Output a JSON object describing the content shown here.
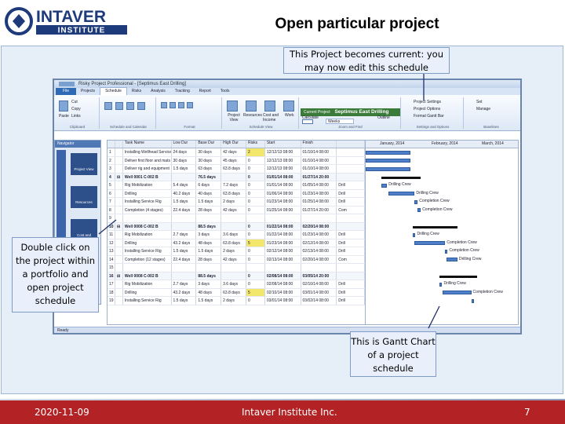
{
  "slide": {
    "title": "Open particular project",
    "logo_text": "INTAVER",
    "logo_subtext": "INSTITUTE",
    "date": "2020-11-09",
    "company": "Intaver Institute Inc.",
    "page_number": "7"
  },
  "callouts": {
    "project_current": "This Project becomes current: you may now edit this schedule",
    "double_click": "Double click on the project within a portfolio and open project schedule",
    "gantt": "This is Gantt Chart of a project schedule"
  },
  "colors": {
    "footer_bg": "#b32225",
    "logo_blue": "#1d3b7a",
    "current_project_bar": "#3a7b3a",
    "gantt_bar": "#4f7fc9"
  },
  "app": {
    "title": "Risky Project Professional - [Septimus East Drilling]",
    "file_tab": "File",
    "tabs": [
      "Projects",
      "Schedule",
      "Risks",
      "Analysis",
      "Tracking",
      "Report",
      "Tools"
    ],
    "active_tab": "Schedule",
    "current_project_label": "Current Project",
    "current_project": "Septimus East Drilling",
    "ribbon_groups": [
      "Clipboard",
      "Schedule and Calendar",
      "Format",
      "Schedule View",
      "Zoom and Find",
      "Settings and Options",
      "Baselines"
    ],
    "ribbon_buttons": {
      "cut": "Cut",
      "copy": "Copy",
      "paste": "Paste",
      "links": "Links",
      "project_view": "Project View",
      "resources": "Resources",
      "cost_income": "Cost and Income",
      "work": "Work",
      "calculate": "Calculate",
      "outline": "Outline",
      "weeks": "Weeks",
      "project_settings": "Project Settings",
      "project_options": "Project Options",
      "format_gantt": "Format Gantt Bar",
      "set": "Set",
      "manage": "Manage"
    },
    "navigator": {
      "title": "Navigator",
      "strip_labels": [
        "Projects",
        "Schedule"
      ],
      "buttons": [
        "Project View",
        "Resources",
        "Cost and"
      ]
    },
    "grid": {
      "headers": [
        "",
        "",
        "Task Name",
        "Low Dur",
        "Base Dur",
        "High Dur",
        "Risks",
        "Start",
        "Finish",
        ""
      ],
      "rows": [
        [
          "1",
          "",
          "Installing Wellhead Service",
          "24 days",
          "30 days",
          "42 days",
          "2",
          "12/12/13 08:00",
          "01/10/14 08:00",
          ""
        ],
        [
          "2",
          "",
          "Deliver first floor and mats",
          "30 days",
          "30 days",
          "45 days",
          "0",
          "12/12/13 08:00",
          "01/10/14 08:00",
          ""
        ],
        [
          "3",
          "",
          "Deliver rig and equipment",
          "1.5 days",
          "63 days",
          "63.8 days",
          "0",
          "12/12/13 08:00",
          "01/10/14 08:00",
          ""
        ],
        [
          "4",
          "⊟",
          "Well 0001 C-002 B",
          "",
          "76.5 days",
          "",
          "0",
          "01/01/14 08:00",
          "01/27/14 20:00",
          ""
        ],
        [
          "5",
          "",
          "Rig Mobilization",
          "5.4 days",
          "6 days",
          "7.2 days",
          "0",
          "01/01/14 08:00",
          "01/05/14 08:00",
          "Drill"
        ],
        [
          "6",
          "",
          "Drilling",
          "40.2 days",
          "40 days",
          "63.8 days",
          "0",
          "01/06/14 08:00",
          "01/23/14 08:00",
          "Drill"
        ],
        [
          "7",
          "",
          "Installing Service Rig",
          "1.5 days",
          "1.5 days",
          "2 days",
          "0",
          "01/23/14 08:00",
          "01/25/14 08:00",
          "Drill"
        ],
        [
          "8",
          "",
          "Completion (4 stages)",
          "22.4 days",
          "28 days",
          "42 days",
          "0",
          "01/25/14 08:00",
          "01/27/14 20:00",
          "Com"
        ],
        [
          "9",
          "",
          "",
          "",
          "",
          "",
          "",
          "",
          "",
          ""
        ],
        [
          "10",
          "⊟",
          "Well 0008 C-002 B",
          "",
          "88.5 days",
          "",
          "0",
          "01/22/14 08:00",
          "02/20/14 08:00",
          ""
        ],
        [
          "11",
          "",
          "Rig Mobilization",
          "2.7 days",
          "3 days",
          "3.6 days",
          "0",
          "01/22/14 08:00",
          "01/23/14 08:00",
          "Drill"
        ],
        [
          "12",
          "",
          "Drilling",
          "43.2 days",
          "48 days",
          "63.8 days",
          "5",
          "01/23/14 08:00",
          "02/12/14 08:00",
          "Drill"
        ],
        [
          "13",
          "",
          "Installing Service Rig",
          "1.5 days",
          "1.5 days",
          "2 days",
          "0",
          "02/12/14 08:00",
          "02/13/14 08:00",
          "Drill"
        ],
        [
          "14",
          "",
          "Completion (12 stages)",
          "22.4 days",
          "28 days",
          "42 days",
          "0",
          "02/13/14 08:00",
          "02/20/14 08:00",
          "Com"
        ],
        [
          "15",
          "",
          "",
          "",
          "",
          "",
          "",
          "",
          "",
          ""
        ],
        [
          "16",
          "⊟",
          "Well 0008 C-002 B",
          "",
          "88.5 days",
          "",
          "0",
          "02/08/14 08:00",
          "03/05/14 20:00",
          ""
        ],
        [
          "17",
          "",
          "Rig Mobilization",
          "2.7 days",
          "3 days",
          "3.6 days",
          "0",
          "02/08/14 08:00",
          "02/10/14 08:00",
          "Drill"
        ],
        [
          "18",
          "",
          "Drilling",
          "43.2 days",
          "48 days",
          "63.8 days",
          "5",
          "02/10/14 08:00",
          "03/01/14 08:00",
          "Drill"
        ],
        [
          "19",
          "",
          "Installing Service Rig",
          "1.5 days",
          "1.5 days",
          "2 days",
          "0",
          "03/01/14 08:00",
          "03/02/14 08:00",
          "Drill"
        ]
      ]
    },
    "gantt": {
      "months": [
        "January, 2014",
        "February, 2014",
        "March, 2014"
      ],
      "labels": [
        "Drilling Crew",
        "Drilling Crew",
        "Completion Crew",
        "Completion Crew",
        "Drilling Crew",
        "Completion Crew",
        "Completion Crew",
        "Drilling Crew",
        "Drilling Crew",
        "Completion Crew"
      ]
    },
    "status": "Ready"
  }
}
